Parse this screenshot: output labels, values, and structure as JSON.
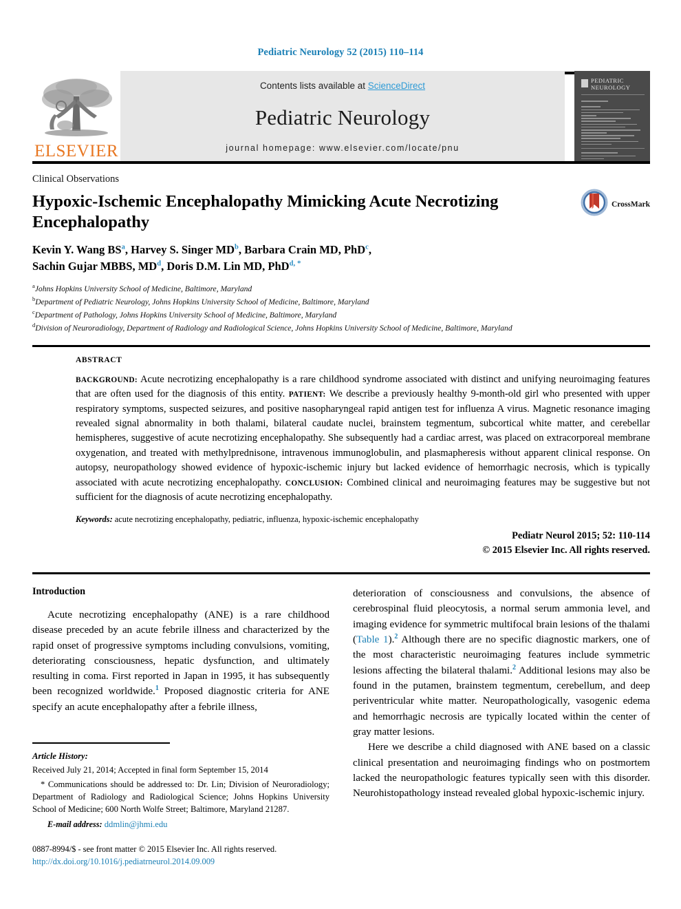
{
  "running_head": "Pediatric Neurology 52 (2015) 110–114",
  "masthead": {
    "publisher_wordmark": "ELSEVIER",
    "contents_prefix": "Contents lists available at ",
    "contents_link": "ScienceDirect",
    "journal_title": "Pediatric Neurology",
    "homepage_line": "journal homepage: www.elsevier.com/locate/pnu",
    "cover_title_line1": "PEDIATRIC",
    "cover_title_line2": "NEUROLOGY",
    "accent_orange": "#E87722",
    "link_blue": "#2e9bd6",
    "masthead_gray": "#e7e7e7",
    "cover_gray": "#4a4a4a"
  },
  "article": {
    "section_kicker": "Clinical Observations",
    "title": "Hypoxic-Ischemic Encephalopathy Mimicking Acute Necrotizing Encephalopathy",
    "crossmark_label": "CrossMark",
    "authors_line1_part1": "Kevin Y. Wang BS",
    "authors_line1_sup1": "a",
    "authors_line1_part2": ", Harvey S. Singer MD",
    "authors_line1_sup2": "b",
    "authors_line1_part3": ", Barbara Crain MD, PhD",
    "authors_line1_sup3": "c",
    "authors_line1_part4": ",",
    "authors_line2_part1": "Sachin Gujar MBBS, MD",
    "authors_line2_sup1": "d",
    "authors_line2_part2": ", Doris D.M. Lin MD, PhD",
    "authors_line2_sup2": "d",
    "authors_line2_star": ", *",
    "affiliations": [
      {
        "marker": "a",
        "text": "Johns Hopkins University School of Medicine, Baltimore, Maryland"
      },
      {
        "marker": "b",
        "text": "Department of Pediatric Neurology, Johns Hopkins University School of Medicine, Baltimore, Maryland"
      },
      {
        "marker": "c",
        "text": "Department of Pathology, Johns Hopkins University School of Medicine, Baltimore, Maryland"
      },
      {
        "marker": "d",
        "text": "Division of Neuroradiology, Department of Radiology and Radiological Science, Johns Hopkins University School of Medicine, Baltimore, Maryland"
      }
    ]
  },
  "abstract": {
    "heading": "ABSTRACT",
    "label_background": "BACKGROUND:",
    "background_text": " Acute necrotizing encephalopathy is a rare childhood syndrome associated with distinct and unifying neuroimaging features that are often used for the diagnosis of this entity. ",
    "label_patient": "PATIENT:",
    "patient_text": " We describe a previously healthy 9-month-old girl who presented with upper respiratory symptoms, suspected seizures, and positive nasopharyngeal rapid antigen test for influenza A virus. Magnetic resonance imaging revealed signal abnormality in both thalami, bilateral caudate nuclei, brainstem tegmentum, subcortical white matter, and cerebellar hemispheres, suggestive of acute necrotizing encephalopathy. She subsequently had a cardiac arrest, was placed on extracorporeal membrane oxygenation, and treated with methylprednisone, intravenous immunoglobulin, and plasmapheresis without apparent clinical response. On autopsy, neuropathology showed evidence of hypoxic-ischemic injury but lacked evidence of hemorrhagic necrosis, which is typically associated with acute necrotizing encephalopathy. ",
    "label_conclusion": "CONCLUSION:",
    "conclusion_text": " Combined clinical and neuroimaging features may be suggestive but not sufficient for the diagnosis of acute necrotizing encephalopathy.",
    "keywords_label": "Keywords:",
    "keywords_text": " acute necrotizing encephalopathy, pediatric, influenza, hypoxic-ischemic encephalopathy",
    "citation": "Pediatr Neurol 2015; 52: 110-114",
    "copyright": "© 2015 Elsevier Inc. All rights reserved."
  },
  "body": {
    "intro_heading": "Introduction",
    "left_p1_a": "Acute necrotizing encephalopathy (ANE) is a rare childhood disease preceded by an acute febrile illness and characterized by the rapid onset of progressive symptoms including convulsions, vomiting, deteriorating consciousness, hepatic dysfunction, and ultimately resulting in coma. First reported in Japan in 1995, it has subsequently been recognized worldwide.",
    "left_p1_ref": "1",
    "left_p1_b": " Proposed diagnostic criteria for ANE specify an acute encephalopathy after a febrile illness,",
    "right_p1_a": "deterioration of consciousness and convulsions, the absence of cerebrospinal fluid pleocytosis, a normal serum ammonia level, and imaging evidence for symmetric multifocal brain lesions of the thalami (",
    "right_p1_link": "Table 1",
    "right_p1_b": ").",
    "right_p1_ref1": "2",
    "right_p1_c": " Although there are no specific diagnostic markers, one of the most characteristic neuroimaging features include symmetric lesions affecting the bilateral thalami.",
    "right_p1_ref2": "2",
    "right_p1_d": " Additional lesions may also be found in the putamen, brainstem tegmentum, cerebellum, and deep periventricular white matter. Neuropathologically, vasogenic edema and hemorrhagic necrosis are typically located within the center of gray matter lesions.",
    "right_p2": "Here we describe a child diagnosed with ANE based on a classic clinical presentation and neuroimaging findings who on postmortem lacked the neuropathologic features typically seen with this disorder. Neurohistopathology instead revealed global hypoxic-ischemic injury."
  },
  "footer": {
    "history_heading": "Article History:",
    "history_line": "Received July 21, 2014; Accepted in final form September 15, 2014",
    "correspondence": "* Communications should be addressed to: Dr. Lin; Division of Neuroradiology; Department of Radiology and Radiological Science; Johns Hopkins University School of Medicine; 600 North Wolfe Street; Baltimore, Maryland 21287.",
    "email_label": "E-mail address:",
    "email_value": "ddmlin@jhmi.edu",
    "issn_line": "0887-8994/$ - see front matter © 2015 Elsevier Inc. All rights reserved.",
    "doi_line": "http://dx.doi.org/10.1016/j.pediatrneurol.2014.09.009"
  }
}
